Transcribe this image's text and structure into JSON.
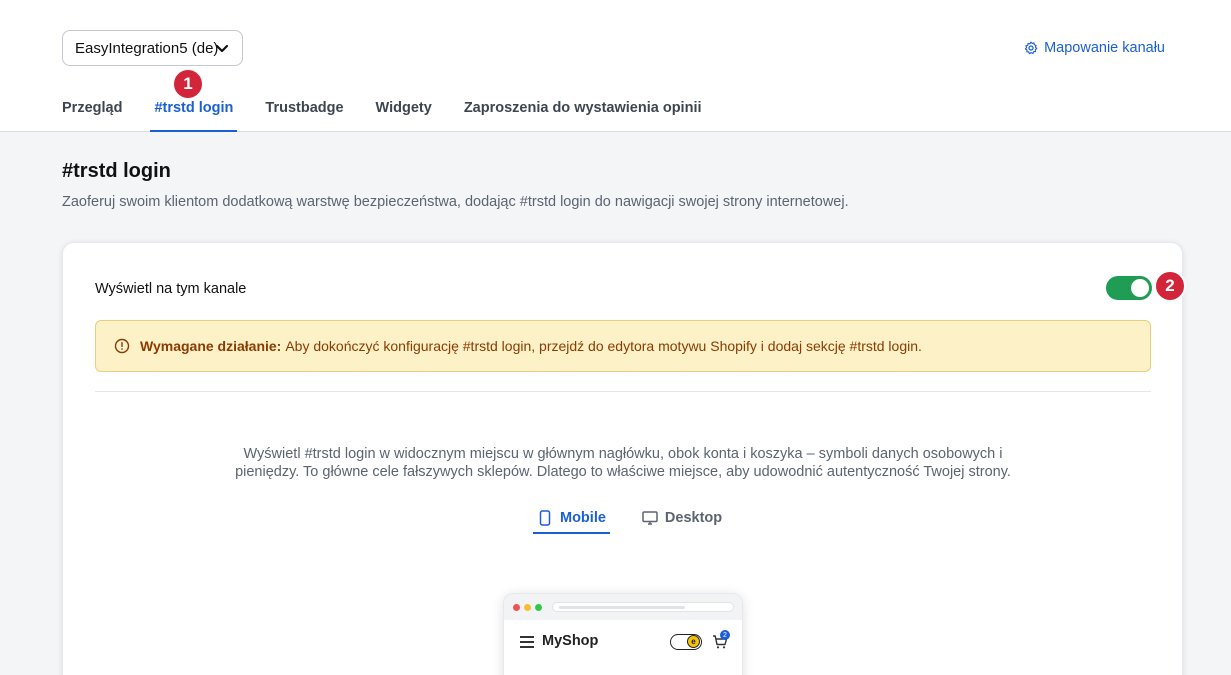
{
  "header": {
    "channel_select": "EasyIntegration5 (de)",
    "mapping_link": "Mapowanie kanału",
    "tabs": [
      {
        "label": "Przegląd"
      },
      {
        "label": "#trstd login"
      },
      {
        "label": "Trustbadge"
      },
      {
        "label": "Widgety"
      },
      {
        "label": "Zaproszenia do wystawienia opinii"
      }
    ],
    "active_tab": "#trstd login"
  },
  "markers": {
    "one": "1",
    "two": "2"
  },
  "page": {
    "title": "#trstd login",
    "subtitle": "Zaoferuj swoim klientom dodatkową warstwę bezpieczeństwa, dodając #trstd login do nawigacji swojej strony internetowej."
  },
  "card": {
    "display_label": "Wyświetl na tym kanale",
    "display_enabled": true,
    "alert": {
      "title": "Wymagane działanie:",
      "text": "Aby dokończyć konfigurację #trstd login, przejdź do edytora motywu Shopify i dodaj sekcję #trstd login."
    },
    "description": "Wyświetl #trstd login w widocznym miejscu w głównym nagłówku, obok konta i koszyka – symboli danych osobowych i pieniędzy. To główne cele fałszywych sklepów. Dlatego to właściwe miejsce, aby udowodnić autentyczność Twojej strony.",
    "mode_tabs": [
      {
        "label": "Mobile",
        "icon": "smartphone-icon"
      },
      {
        "label": "Desktop",
        "icon": "monitor-icon"
      }
    ],
    "active_mode": "Mobile"
  },
  "preview": {
    "shop_name": "MyShop",
    "badge_letter": "e",
    "cart_count": "2"
  },
  "colors": {
    "accent": "#1b5fd6",
    "toggle_on": "#1f9d55",
    "marker": "#d3253a",
    "alert_bg": "#fdf1c7",
    "alert_text": "#8a3b00"
  }
}
